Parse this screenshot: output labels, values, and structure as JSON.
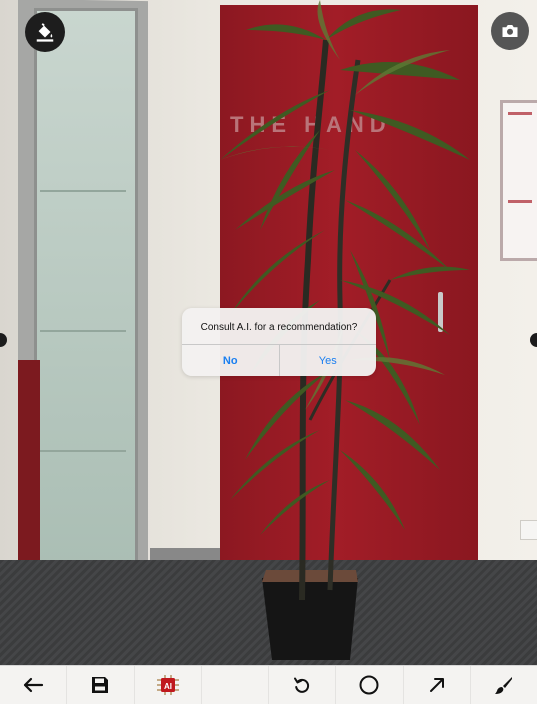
{
  "scene": {
    "door_sign_text": "THE HAND",
    "icons": {
      "top_left": "paint-bucket-icon",
      "top_right": "camera-icon"
    }
  },
  "dialog": {
    "message": "Consult A.I. for a recommendation?",
    "no_label": "No",
    "yes_label": "Yes"
  },
  "toolbar": {
    "items": [
      {
        "icon": "arrow-left-icon"
      },
      {
        "icon": "save-icon"
      },
      {
        "icon": "ai-chip-icon",
        "label": "AI"
      },
      {
        "icon": ""
      },
      {
        "icon": "undo-icon"
      },
      {
        "icon": "circle-icon"
      },
      {
        "icon": "arrow-up-right-icon"
      },
      {
        "icon": "brush-icon"
      }
    ]
  },
  "colors": {
    "accent": "#1a7ff0",
    "door": "#a21d27",
    "ai_chip": "#c0181d"
  }
}
